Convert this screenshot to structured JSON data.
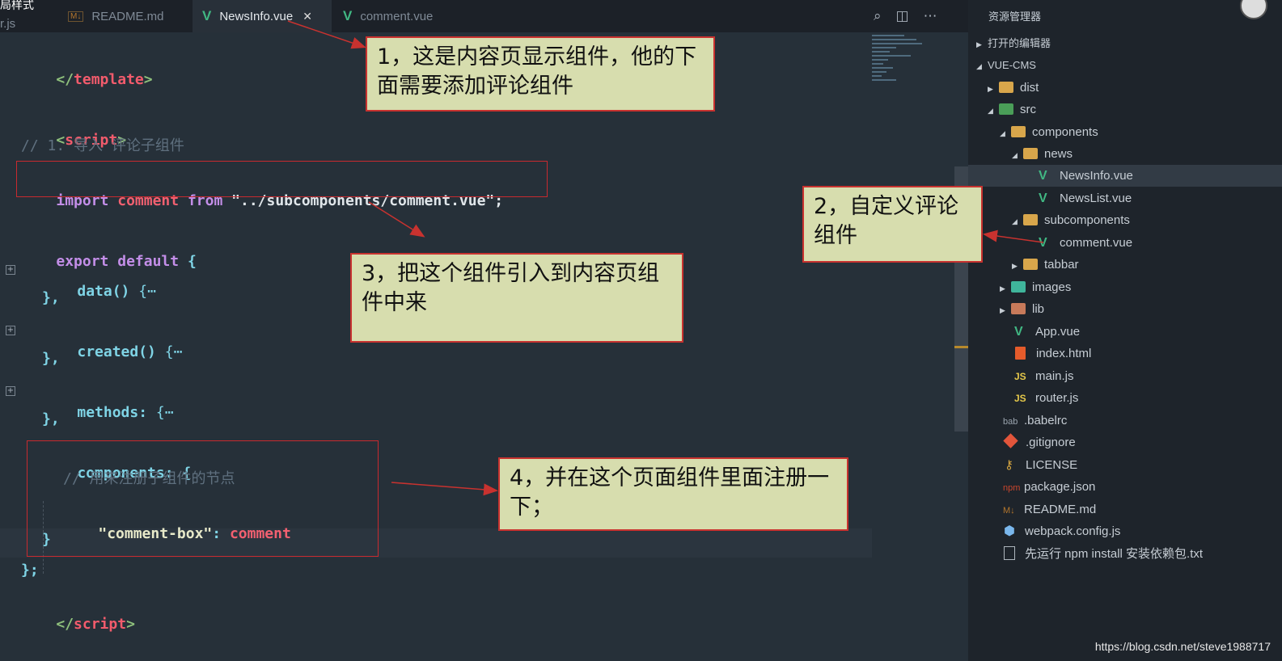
{
  "corner_text": "局样式",
  "tabs": [
    {
      "label": "r.js",
      "icon": "js-file-icon"
    },
    {
      "label": "README.md",
      "icon": "markdown-icon"
    },
    {
      "label": "NewsInfo.vue",
      "icon": "vue-icon",
      "active": true
    },
    {
      "label": "comment.vue",
      "icon": "vue-icon"
    }
  ],
  "explorer": {
    "title": "资源管理器",
    "open_editors": "打开的编辑器",
    "project": "VUE-CMS",
    "items": [
      {
        "label": "dist"
      },
      {
        "label": "src"
      },
      {
        "label": "components"
      },
      {
        "label": "news"
      },
      {
        "label": "NewsInfo.vue"
      },
      {
        "label": "NewsList.vue"
      },
      {
        "label": "subcomponents"
      },
      {
        "label": "comment.vue"
      },
      {
        "label": "tabbar"
      },
      {
        "label": "images"
      },
      {
        "label": "lib"
      },
      {
        "label": "App.vue"
      },
      {
        "label": "index.html"
      },
      {
        "label": "main.js"
      },
      {
        "label": "router.js"
      },
      {
        "label": ".babelrc"
      },
      {
        "label": ".gitignore"
      },
      {
        "label": "LICENSE"
      },
      {
        "label": "package.json"
      },
      {
        "label": "README.md"
      },
      {
        "label": "webpack.config.js"
      },
      {
        "label": "先运行 npm install 安装依赖包.txt"
      }
    ]
  },
  "code": {
    "l1_tag": "template",
    "l2_tag": "script",
    "l3_comment": "// 1. 导入 评论子组件",
    "l4_import": "import",
    "l4_var": "comment",
    "l4_from": "from",
    "l4_path": "\"../subcomponents/comment.vue\"",
    "l4_semi": ";",
    "l5_export": "export",
    "l5_default": "default",
    "l5_brace": "{",
    "l6_fn": "data()",
    "l6_rest": "{⋯",
    "l7": "},",
    "l8_fn": "created()",
    "l8_rest": "{⋯",
    "l9": "},",
    "l10_fn": "methods:",
    "l10_rest": "{⋯",
    "l11": "},",
    "l12_fn": "components:",
    "l12_rest": "{",
    "l13_comment": "// 用来注册子组件的节点",
    "l14_key": "\"comment-box\"",
    "l14_colon": ":",
    "l14_val": "comment",
    "l15": "}",
    "l16": "};",
    "l17_tag": "script"
  },
  "callouts": {
    "c1": "1，这是内容页显示组件，他的下面需要添加评论组件",
    "c2": "2，自定义评论组件",
    "c3": "3，把这个组件引入到内容页组件中来",
    "c4": "4，并在这个页面组件里面注册一下；"
  },
  "watermark": "https://blog.csdn.net/steve1988717"
}
